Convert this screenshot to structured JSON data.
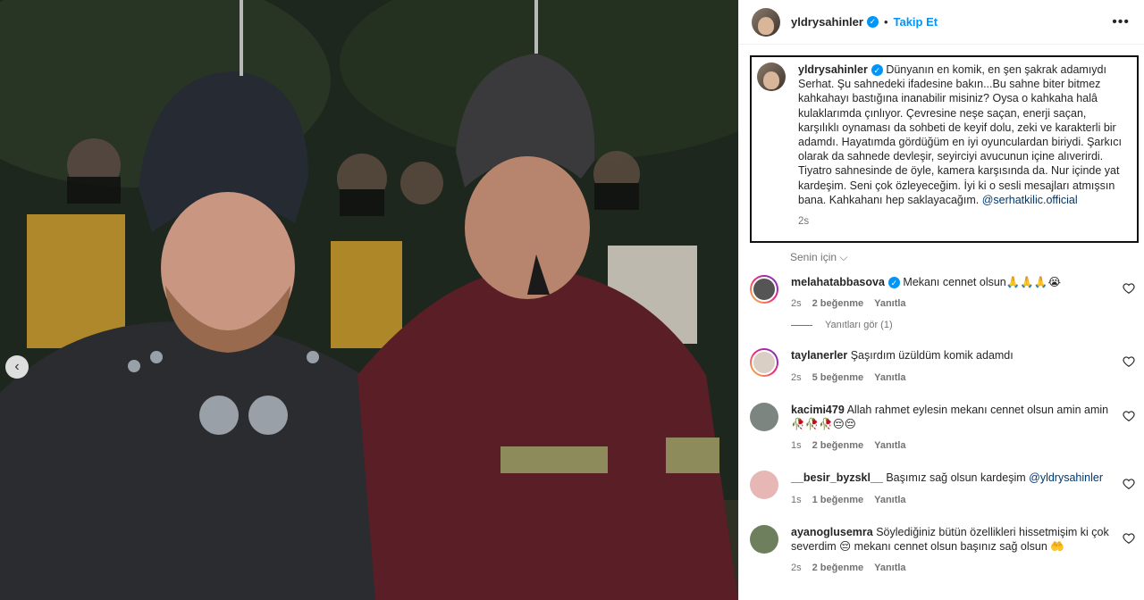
{
  "photo": {
    "nav_left": "‹"
  },
  "post": {
    "username": "yldrysahinler",
    "follow_label": "Takip Et",
    "more": "•••",
    "caption_text": "Dünyanın en komik, en şen şakrak adamıydı Serhat. Şu sahnedeki ifadesine bakın...Bu sahne biter bitmez kahkahayı bastığına inanabilir misiniz? Oysa o kahkaha halâ kulaklarımda çınlıyor. Çevresine neşe saçan, enerji saçan, karşılıklı oynaması da sohbeti de keyif dolu, zeki ve karakterli bir adamdı. Hayatımda gördüğüm en iyi oyunculardan biriydi. Şarkıcı olarak da sahnede devleşir, seyirciyi avucunun içine alıverirdi. Tiyatro sahnesinde de öyle, kamera karşısında da. Nur içinde yat kardeşim. Seni çok özleyeceğim. İyi ki o sesli mesajları atmışsın bana. Kahkahanı hep saklayacağım.",
    "caption_mention": "@serhatkilic.official",
    "time": "2s",
    "senin_icin": "Senin için"
  },
  "comments": [
    {
      "user": "melahatabbasova",
      "verified": true,
      "text": "Mekanı cennet olsun🙏🙏🙏😭",
      "time": "2s",
      "likes": "2 beğenme",
      "reply": "Yanıtla",
      "view_replies": "Yanıtları gör (1)"
    },
    {
      "user": "taylanerler",
      "text": "Şaşırdım üzüldüm komik adamdı",
      "time": "2s",
      "likes": "5 beğenme",
      "reply": "Yanıtla"
    },
    {
      "user": "kacimi479",
      "text": "Allah rahmet eylesin mekanı cennet olsun amin amin 🥀🥀🥀😔😔",
      "time": "1s",
      "likes": "2 beğenme",
      "reply": "Yanıtla"
    },
    {
      "user": "__besir_byzskl__",
      "text": "Başımız sağ olsun kardeşim",
      "mention": "@yldrysahinler",
      "time": "1s",
      "likes": "1 beğenme",
      "reply": "Yanıtla"
    },
    {
      "user": "ayanoglusemra",
      "text": "Söylediğiniz bütün özellikleri hissetmişim ki çok severdim 😔 mekanı cennet olsun başınız sağ olsun 🤲",
      "time": "2s",
      "likes": "2 beğenme",
      "reply": "Yanıtla"
    }
  ]
}
